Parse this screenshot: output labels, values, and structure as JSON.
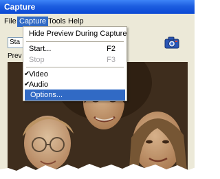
{
  "window": {
    "title": "Capture"
  },
  "menubar": [
    {
      "label": "File",
      "active": false
    },
    {
      "label": "Capture",
      "active": true
    },
    {
      "label": "Tools",
      "active": false
    },
    {
      "label": "Help",
      "active": false
    }
  ],
  "toolbar": {
    "start_label": "Sta"
  },
  "preview": {
    "label": "Prev"
  },
  "capture_menu": {
    "items": [
      {
        "label": "Hide Preview During Capture",
        "shortcut": "",
        "checked": false,
        "disabled": false,
        "highlighted": false
      },
      {
        "label": "Start...",
        "shortcut": "F2",
        "checked": false,
        "disabled": false,
        "highlighted": false
      },
      {
        "label": "Stop",
        "shortcut": "F3",
        "checked": false,
        "disabled": true,
        "highlighted": false
      },
      {
        "label": "Video",
        "shortcut": "",
        "checked": true,
        "disabled": false,
        "highlighted": false
      },
      {
        "label": "Audio",
        "shortcut": "",
        "checked": true,
        "disabled": false,
        "highlighted": false
      },
      {
        "label": "Options...",
        "shortcut": "",
        "checked": false,
        "disabled": false,
        "highlighted": true
      }
    ]
  },
  "colors": {
    "titlebar": "#0a48d4",
    "menu_highlight": "#316ac5",
    "window_bg": "#ece9d8"
  },
  "icons": {
    "camera": "camera-icon",
    "check": "check-icon"
  }
}
